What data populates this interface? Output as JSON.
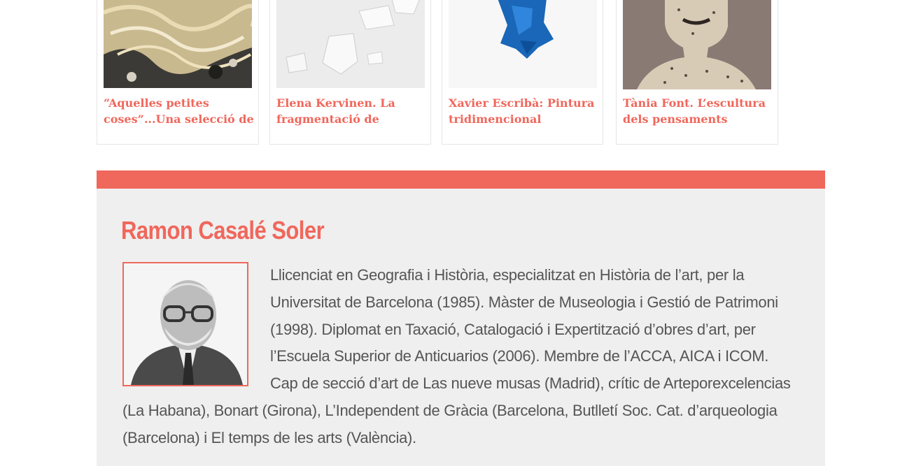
{
  "related": {
    "items": [
      {
        "title": "“Aquelles petites coses”...Una selecció de",
        "image": "abstract-painting-thumbnail"
      },
      {
        "title": "Elena Kervinen. La fragmentació de",
        "image": "white-fragments-thumbnail"
      },
      {
        "title": "Xavier Escribà: Pintura tridimencional",
        "image": "blue-sculpture-thumbnail"
      },
      {
        "title": "Tània Font. L’escultura dels pensaments",
        "image": "bust-sculpture-thumbnail"
      }
    ]
  },
  "author": {
    "name": "Ramon Casalé Soler",
    "photo": "author-portrait",
    "bio": "Llicenciat en Geografia i Història, especialitzat en Història de l’art, per la Universitat de Barcelona (1985). Màster de Museologia i Gestió de Patrimoni (1998). Diplomat en Taxació, Catalogació i Expertització d’obres d’art, per l’Escuela Superior de Anticuarios (2006). Membre de l’ACCA, AICA i ICOM. Cap de secció d’art de Las nueve musas (Madrid), crític de Arteporexcelencias (La Habana), Bonart (Girona), L’Independent de Gràcia (Barcelona, Butlletí Soc. Cat. d’arqueologia (Barcelona) i El temps de les arts (València)."
  },
  "colors": {
    "accent": "#f0675c",
    "panel": "#efefef",
    "text": "#555555"
  }
}
